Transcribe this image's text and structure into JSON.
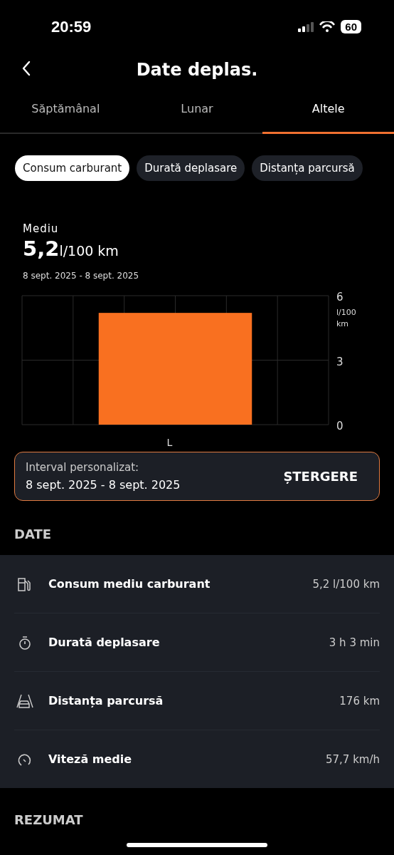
{
  "status_bar": {
    "time": "20:59",
    "battery": "60"
  },
  "header": {
    "title": "Date deplas."
  },
  "tabs": [
    {
      "label": "Săptămânal",
      "selected": false
    },
    {
      "label": "Lunar",
      "selected": false
    },
    {
      "label": "Altele",
      "selected": true
    }
  ],
  "filters": [
    {
      "label": "Consum carburant",
      "selected": true
    },
    {
      "label": "Durată deplasare",
      "selected": false
    },
    {
      "label": "Distanța parcursă",
      "selected": false
    }
  ],
  "summary": {
    "label": "Mediu",
    "value": "5,2",
    "unit": "l/100 km",
    "date_range": "8 sept. 2025 - 8 sept. 2025"
  },
  "chart": {
    "chart_data": {
      "type": "bar",
      "categories": [
        "L"
      ],
      "values": [
        5.2
      ],
      "ylim": [
        0,
        6
      ],
      "yticks": [
        0,
        3,
        6
      ],
      "ylabel": "l/100 km",
      "color": "#f97020"
    }
  },
  "interval": {
    "label": "Interval personalizat:",
    "range": "8 sept. 2025 - 8 sept. 2025",
    "action": "ȘTERGERE"
  },
  "data_section": {
    "title": "DATE",
    "rows": [
      {
        "kind": "fuel",
        "label": "Consum mediu carburant",
        "value": "5,2 l/100 km"
      },
      {
        "kind": "timer",
        "label": "Durată deplasare",
        "value": "3 h 3 min"
      },
      {
        "kind": "road",
        "label": "Distanța parcursă",
        "value": "176 km"
      },
      {
        "kind": "gauge",
        "label": "Viteză medie",
        "value": "57,7 km/h"
      }
    ]
  },
  "summary_section": {
    "title": "REZUMAT"
  }
}
